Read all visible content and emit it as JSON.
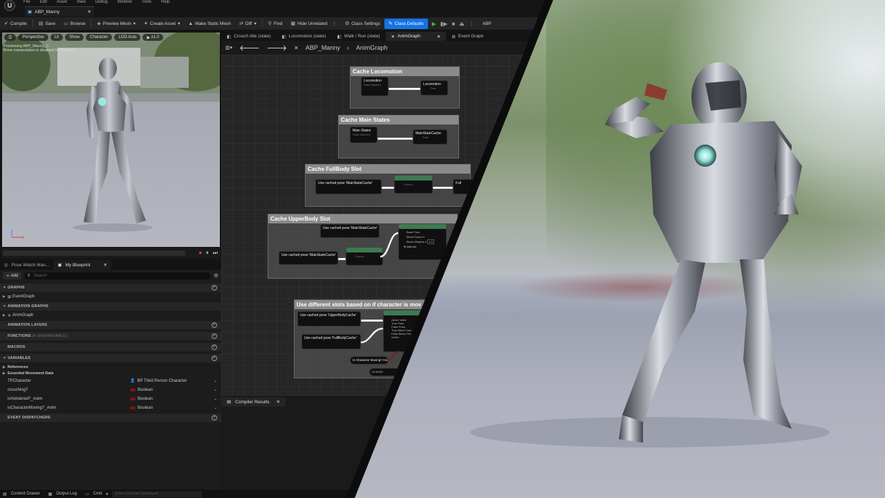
{
  "menu": [
    "File",
    "Edit",
    "Asset",
    "View",
    "Debug",
    "Window",
    "Tools",
    "Help"
  ],
  "document_tab": "ABP_Manny",
  "toolbar": {
    "compile": "Compile",
    "save": "Save",
    "browse": "Browse",
    "preview_mesh": "Preview Mesh",
    "create_asset": "Create Asset",
    "make_static_mesh": "Make Static Mesh",
    "diff": "Diff",
    "find": "Find",
    "hide_unrelated": "Hide Unrelated",
    "class_settings": "Class Settings",
    "class_defaults": "Class Defaults",
    "parent_label": "ABP"
  },
  "viewport": {
    "perspective": "Perspective",
    "lit": "Lit",
    "show": "Show",
    "character": "Character",
    "lod": "LOD Auto",
    "speed": "x1.0",
    "note_line1": "Previewing ABP_Manny_C.",
    "note_line2": "Bone manipulation is disabled in this mode."
  },
  "panel_tabs": {
    "pose_watch": "Pose Watch Man...",
    "my_blueprint": "My Blueprint"
  },
  "my_blueprint": {
    "add_label": "Add",
    "search_placeholder": "Search",
    "sections": {
      "graphs": "GRAPHS",
      "animation_graphs": "ANIMATION GRAPHS",
      "animation_layers": "ANIMATION LAYERS",
      "functions": "FUNCTIONS",
      "functions_count": "(4 OVERRIDABLE)",
      "macros": "MACROS",
      "variables": "VARIABLES",
      "event_dispatchers": "EVENT DISPATCHERS"
    },
    "event_graph": "EventGraph",
    "anim_graph": "AnimGraph",
    "categories": [
      "References",
      "Essential Movement Data"
    ],
    "variables": [
      {
        "name": "TPCharacter",
        "type": "BP Third Person Character",
        "color": "#3a8ee6"
      },
      {
        "name": "crouching?",
        "type": "Boolean",
        "color": "#8a1111"
      },
      {
        "name": "isHolstered?_Anim",
        "type": "Boolean",
        "color": "#8a1111"
      },
      {
        "name": "isCharacterMoving?_Anim",
        "type": "Boolean",
        "color": "#8a1111"
      }
    ]
  },
  "graph_tabs": [
    "Crouch Idle (state)",
    "Locomotion (state)",
    "Walk / Run (state)",
    "AnimGraph",
    "Event Graph"
  ],
  "breadcrumb": {
    "asset": "ABP_Manny",
    "graph": "AnimGraph"
  },
  "comments": {
    "c1": "Cache Locomotion",
    "c2": "Cache Main States",
    "c3": "Cache FullBody Slot",
    "c4": "Cache UpperBody Slot",
    "c5": "Use different slots based on if character is mov"
  },
  "nodes": {
    "locomotion_sm": "Locomotion",
    "locomotion_sm_sub": "State Machine",
    "locomotion_cache": "Locomotion",
    "pose": "Pose",
    "mainstates_sm": "Main States",
    "mainstates_sub": "State Machine",
    "mainstate_cache": "MainStateCache",
    "use_main_cache": "Use cached pose 'MainStateCache'",
    "slot_fullbody": "Slot 'FullBody'",
    "slot_sub": "Slot 'DefaultGroup'",
    "source": "Source",
    "full_cut": "Full",
    "use_main_cache2": "Use cached pose 'MainStateCache'",
    "use_main_cache3": "Use cached pose 'MainStateCache'",
    "slot_upperbody": "Slot 'UpperBody'",
    "layered_blend": "Layered blend per bone",
    "base_pose": "Base Pose",
    "blend_poses0": "Blend Poses 0",
    "blend_weights0": "Blend Weights 0",
    "blend_weight_val": "1.0",
    "add_pin": "Add pin",
    "use_upper_cache": "Use cached pose 'UpperBodyCache'",
    "use_full_cache": "Use cached pose 'FullBodyCache'",
    "blend_bool": "Blend Poses by bool",
    "active_value": "Active Value",
    "true_pose": "True Pose",
    "false_pose": "False Pose",
    "true_blend": "True Blend Time",
    "false_blend": "False Blend Time",
    "active_child": "Active",
    "is_moving": "Is Character Moving? Anim",
    "unused": "Unused"
  },
  "compiler_tab": "Compiler Results",
  "status": {
    "content_drawer": "Content Drawer",
    "output_log": "Output Log",
    "cmd": "Cmd",
    "console_placeholder": "Enter Console Command"
  },
  "colors": {
    "accent": "#1473e6",
    "node_green": "#3d7a52",
    "bool_pin": "#8a1111",
    "object_pin": "#3a8ee6",
    "play_green": "#4caf50"
  }
}
